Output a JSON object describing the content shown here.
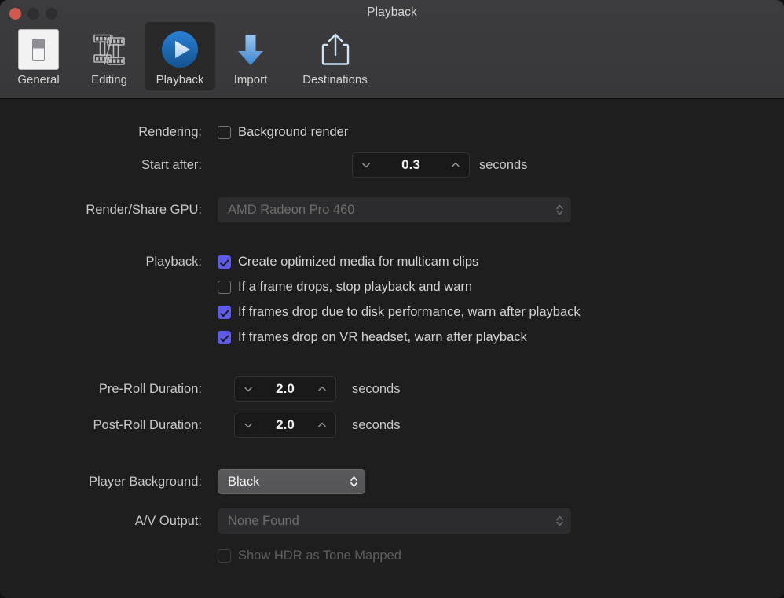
{
  "window": {
    "title": "Playback",
    "traffic_lights": [
      "close-button",
      "minimize-button",
      "zoom-button"
    ]
  },
  "toolbar": {
    "items": [
      {
        "label": "General",
        "icon": "general-toggle-icon",
        "selected": false
      },
      {
        "label": "Editing",
        "icon": "film-strip-icon",
        "selected": false
      },
      {
        "label": "Playback",
        "icon": "play-circle-icon",
        "selected": true
      },
      {
        "label": "Import",
        "icon": "download-arrow-icon",
        "selected": false
      },
      {
        "label": "Destinations",
        "icon": "share-export-icon",
        "selected": false
      }
    ]
  },
  "settings": {
    "rendering": {
      "label": "Rendering:",
      "background_render": {
        "label": "Background render",
        "checked": false,
        "enabled": true
      },
      "start_after": {
        "label": "Start after:",
        "value": "0.3",
        "units": "seconds"
      }
    },
    "render_share_gpu": {
      "label": "Render/Share GPU:",
      "value": "AMD Radeon Pro 460",
      "enabled": false
    },
    "playback": {
      "label": "Playback:",
      "options": [
        {
          "label": "Create optimized media for multicam clips",
          "checked": true,
          "enabled": true
        },
        {
          "label": "If a frame drops, stop playback and warn",
          "checked": false,
          "enabled": true
        },
        {
          "label": "If frames drop due to disk performance, warn after playback",
          "checked": true,
          "enabled": true
        },
        {
          "label": "If frames drop on VR headset, warn after playback",
          "checked": true,
          "enabled": true
        }
      ]
    },
    "pre_roll": {
      "label": "Pre-Roll Duration:",
      "value": "2.0",
      "units": "seconds"
    },
    "post_roll": {
      "label": "Post-Roll Duration:",
      "value": "2.0",
      "units": "seconds"
    },
    "player_background": {
      "label": "Player Background:",
      "value": "Black",
      "enabled": true
    },
    "av_output": {
      "label": "A/V Output:",
      "value": "None Found",
      "enabled": false
    },
    "show_hdr": {
      "label": "Show HDR as Tone Mapped",
      "checked": false,
      "enabled": false
    }
  },
  "colors": {
    "checkbox_accent": "#5e5ce6",
    "toolbar_bg": "#3a3a3c",
    "content_bg": "#1e1e1e",
    "close_button": "#cf5b4f",
    "play_icon_blue": "#1f6fc4",
    "import_arrow_blue": "#5f9fe0"
  }
}
